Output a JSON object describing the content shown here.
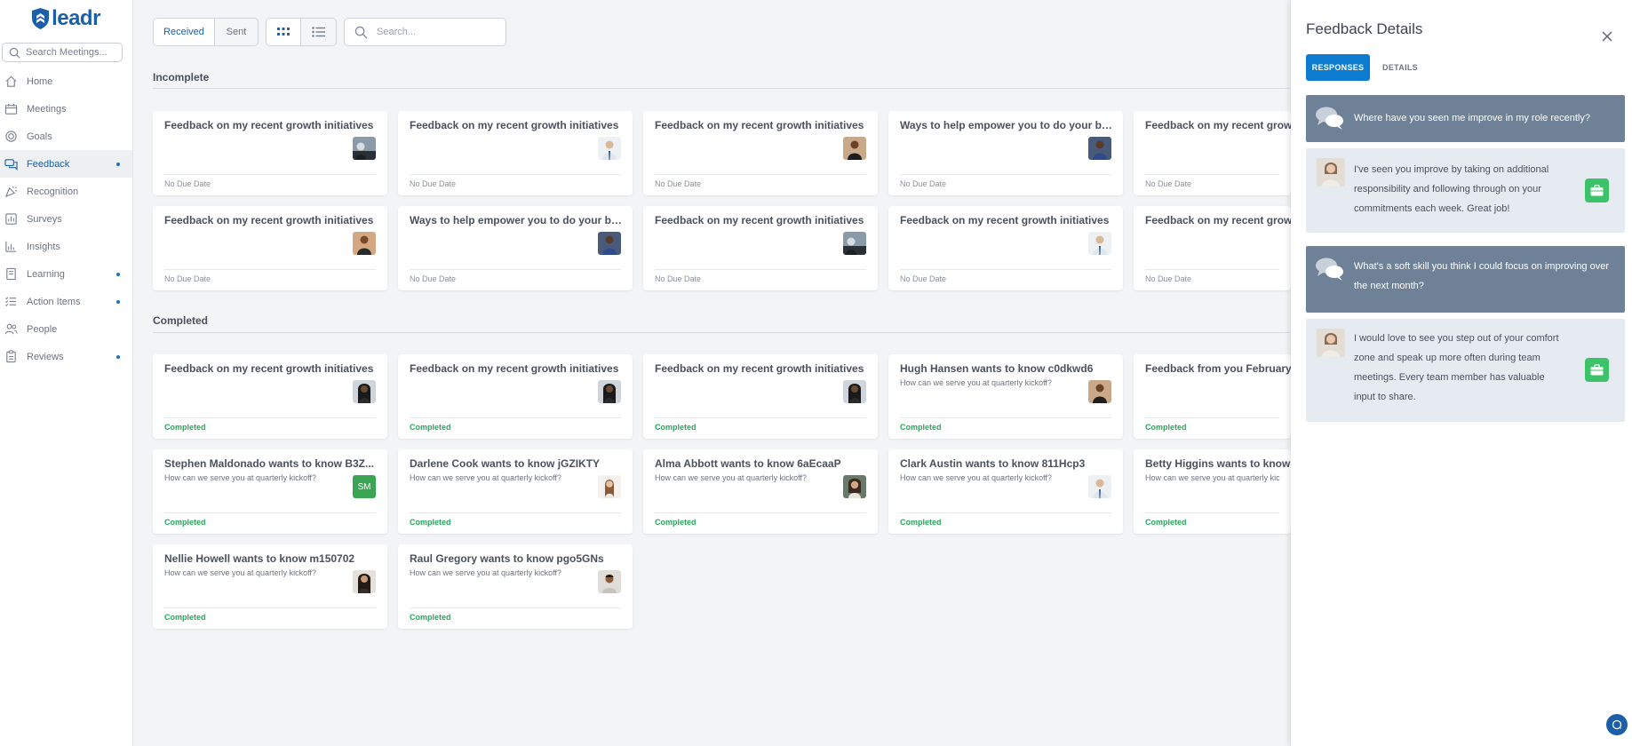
{
  "brand": {
    "logo_text": "leadr",
    "color": "#1d5fa6"
  },
  "sidebar": {
    "search_placeholder": "Search Meetings...",
    "items": [
      {
        "label": "Home",
        "icon": "home-icon",
        "active": false,
        "dot": false
      },
      {
        "label": "Meetings",
        "icon": "meetings-icon",
        "active": false,
        "dot": false
      },
      {
        "label": "Goals",
        "icon": "goals-icon",
        "active": false,
        "dot": false
      },
      {
        "label": "Feedback",
        "icon": "feedback-icon",
        "active": true,
        "dot": true
      },
      {
        "label": "Recognition",
        "icon": "recognition-icon",
        "active": false,
        "dot": false
      },
      {
        "label": "Surveys",
        "icon": "surveys-icon",
        "active": false,
        "dot": false
      },
      {
        "label": "Insights",
        "icon": "insights-icon",
        "active": false,
        "dot": false
      },
      {
        "label": "Learning",
        "icon": "learning-icon",
        "active": false,
        "dot": true
      },
      {
        "label": "Action Items",
        "icon": "action-items-icon",
        "active": false,
        "dot": true
      },
      {
        "label": "People",
        "icon": "people-icon",
        "active": false,
        "dot": false
      },
      {
        "label": "Reviews",
        "icon": "reviews-icon",
        "active": false,
        "dot": true
      }
    ]
  },
  "toolbar": {
    "received_label": "Received",
    "sent_label": "Sent",
    "grid_view_icon": "grid-view-icon",
    "list_view_icon": "list-view-icon",
    "search_placeholder": "Search..."
  },
  "sections": {
    "incomplete_title": "Incomplete",
    "completed_title": "Completed"
  },
  "incomplete_cards": [
    {
      "title": "Feedback on my recent growth initiatives",
      "footer": "No Due Date"
    },
    {
      "title": "Feedback on my recent growth initiatives",
      "footer": "No Due Date"
    },
    {
      "title": "Feedback on my recent growth initiatives",
      "footer": "No Due Date"
    },
    {
      "title": "Ways to help empower you to do your be...",
      "footer": "No Due Date"
    },
    {
      "title": "Feedback on my recent growth initiatives",
      "footer": "No Due Date"
    },
    {
      "title": "Feedback on my recent growth initiatives",
      "footer": "No Due Date"
    },
    {
      "title": "Ways to help empower you to do your be...",
      "footer": "No Due Date"
    },
    {
      "title": "Feedback on my recent growth initiatives",
      "footer": "No Due Date"
    },
    {
      "title": "Feedback on my recent growth initiatives",
      "footer": "No Due Date"
    },
    {
      "title": "Feedback on my recent growth initiatives",
      "footer": "No Due Date"
    }
  ],
  "completed_cards": [
    {
      "title": "Feedback on my recent growth initiatives",
      "subtitle": "",
      "footer": "Completed"
    },
    {
      "title": "Feedback on my recent growth initiatives",
      "subtitle": "",
      "footer": "Completed"
    },
    {
      "title": "Feedback on my recent growth initiatives",
      "subtitle": "",
      "footer": "Completed"
    },
    {
      "title": "Hugh Hansen wants to know c0dkwd6",
      "subtitle": "How can we serve you at quarterly kickoff?",
      "footer": "Completed"
    },
    {
      "title": "Feedback from you February",
      "subtitle": "",
      "footer": "Completed"
    },
    {
      "title": "Stephen Maldonado wants to know B3Z...",
      "subtitle": "How can we serve you at quarterly kickoff?",
      "footer": "Completed",
      "initials": "SM"
    },
    {
      "title": "Darlene Cook wants to know jGZIKTY",
      "subtitle": "How can we serve you at quarterly kickoff?",
      "footer": "Completed"
    },
    {
      "title": "Alma Abbott wants to know 6aEcaaP",
      "subtitle": "How can we serve you at quarterly kickoff?",
      "footer": "Completed"
    },
    {
      "title": "Clark Austin wants to know 811Hcp3",
      "subtitle": "How can we serve you at quarterly kickoff?",
      "footer": "Completed"
    },
    {
      "title": "Betty Higgins wants to know",
      "subtitle": "How can we serve you at quarterly kic",
      "footer": "Completed"
    },
    {
      "title": "Nellie Howell wants to know m150702",
      "subtitle": "How can we serve you at quarterly kickoff?",
      "footer": "Completed"
    },
    {
      "title": "Raul Gregory wants to know pgo5GNs",
      "subtitle": "How can we serve you at quarterly kickoff?",
      "footer": "Completed"
    }
  ],
  "panel": {
    "title": "Feedback Details",
    "close_icon": "close-icon",
    "tab_responses": "RESPONSES",
    "tab_details": "DETAILS",
    "q1": "Where have you seen me improve in my role recently?",
    "a1": "I've seen you improve by taking on additional responsibility and following through on your commitments each week. Great job!",
    "q2": "What's a soft skill you think I could focus on improving over the next month?",
    "a2": "I would love to see you step out of your comfort zone and speak up more often during team meetings. Every team member has valuable input to share.",
    "accent": "#0d7bd0",
    "question_bg": "#6e8197",
    "answer_bg": "#e6ebf2"
  }
}
